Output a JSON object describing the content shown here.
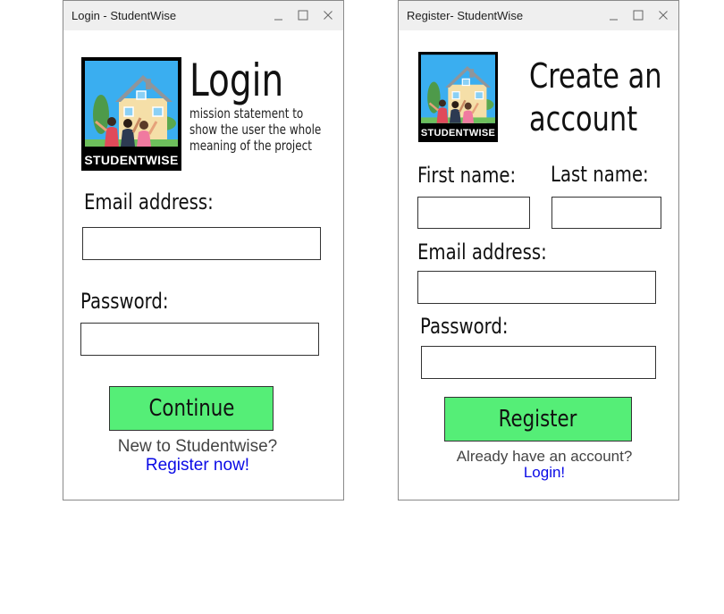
{
  "login_window": {
    "title": "Login - StudentWise",
    "logo_text": "STUDENTWISE",
    "heading": "Login",
    "tagline": [
      "mission statement to",
      "show the user the whole",
      "meaning of the project"
    ],
    "email_label": "Email address:",
    "email_value": "",
    "password_label": "Password:",
    "password_value": "",
    "continue_label": "Continue",
    "new_user_text": "New to Studentwise?",
    "register_link": "Register now!"
  },
  "register_window": {
    "title": "Register- StudentWise",
    "logo_text": "STUDENTWISE",
    "heading_line1": "Create an",
    "heading_line2": "account",
    "first_name_label": "First name:",
    "first_name_value": "",
    "last_name_label": "Last name:",
    "last_name_value": "",
    "email_label": "Email address:",
    "email_value": "",
    "password_label": "Password:",
    "password_value": "",
    "register_label": "Register",
    "have_account_text": "Already have an account?",
    "login_link": "Login!"
  },
  "icons": {
    "window_controls": [
      "minimize-icon",
      "maximize-icon",
      "close-icon"
    ],
    "logo_art": "house-with-students-illustration"
  },
  "colors": {
    "button_green": "#55ee77",
    "link_blue": "#0a0ae6",
    "titlebar": "#efefef",
    "logo_sky": "#3aaef0"
  }
}
